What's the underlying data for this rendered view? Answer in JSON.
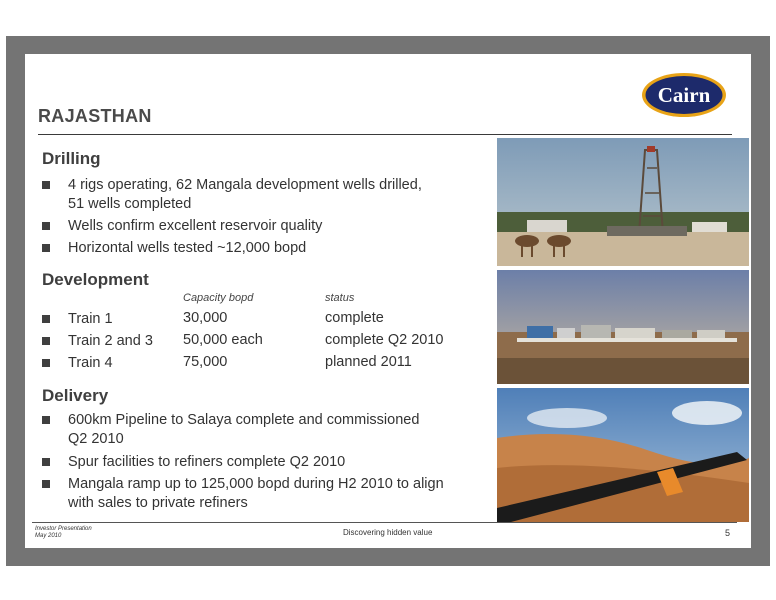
{
  "slide": {
    "title": "RAJASTHAN",
    "logo_text": "Cairn",
    "drilling": {
      "heading": "Drilling",
      "bullets": [
        "4 rigs operating, 62 Mangala development wells drilled,",
        "51 wells completed",
        "Wells confirm excellent reservoir quality",
        "Horizontal wells tested ~12,000 bopd"
      ]
    },
    "development": {
      "heading": "Development",
      "col_capacity": "Capacity bopd",
      "col_status": "status",
      "rows": [
        {
          "name": "Train 1",
          "capacity": "30,000",
          "status": "complete"
        },
        {
          "name": "Train 2 and 3",
          "capacity": "50,000 each",
          "status": "complete Q2 2010"
        },
        {
          "name": "Train 4",
          "capacity": "75,000",
          "status": "planned 2011"
        }
      ]
    },
    "delivery": {
      "heading": "Delivery",
      "bullets": [
        "600km Pipeline to Salaya complete and commissioned",
        "Q2 2010",
        "Spur facilities to refiners complete Q2 2010",
        "Mangala ramp up to 125,000 bopd during H2 2010 to align",
        "with sales to private refiners"
      ]
    },
    "footer": {
      "line1": "Investor Presentation",
      "line2": "May 2010",
      "center": "Discovering hidden value",
      "page": "5"
    }
  },
  "colors": {
    "frame": "#747474",
    "logo_navy": "#1d2a6b",
    "logo_gold": "#e8a317"
  }
}
